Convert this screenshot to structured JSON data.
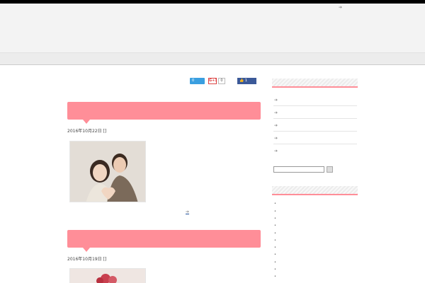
{
  "site": {
    "logo_text": "",
    "subtitle": "",
    "tagline": "",
    "top_link": ""
  },
  "nav": {
    "items": [
      "",
      "",
      ""
    ]
  },
  "social": {
    "tweet_label": "",
    "tweet_count": "0",
    "gplus_label": "G+1",
    "gplus_count": "0",
    "fb_count": "1",
    "tweet_icon": "bird-icon",
    "fb_icon": "thumbs-up-icon"
  },
  "posts": [
    {
      "title": "",
      "date": "2016",
      "date_mid": "10",
      "date_day": "22",
      "category": "",
      "excerpt": "",
      "read_more": ""
    },
    {
      "title": "",
      "date": "2016",
      "date_mid": "10",
      "date_day": "19",
      "category": "",
      "excerpt": "",
      "read_more": ""
    }
  ],
  "sidebar": {
    "recent_heading": "",
    "recent_posts": [
      "",
      "",
      "",
      "",
      ""
    ],
    "search_placeholder": "",
    "categories_heading": "",
    "categories": [
      "",
      "",
      "",
      "",
      "",
      "",
      "",
      "",
      "",
      "",
      "",
      ""
    ]
  },
  "colors": {
    "accent": "#ff8e98",
    "logo": "#e46a78",
    "link": "#1f4f9a"
  }
}
